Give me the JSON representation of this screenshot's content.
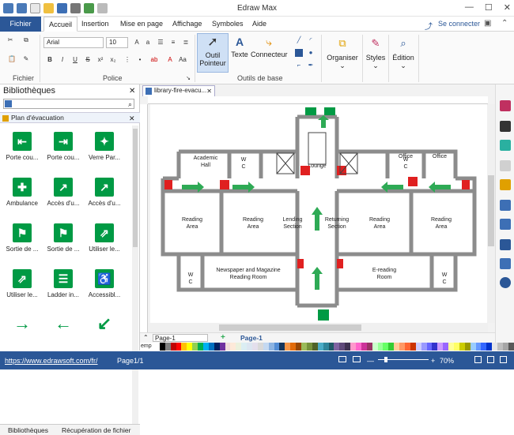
{
  "app": {
    "title": "Edraw Max"
  },
  "window": {
    "minimize": "—",
    "maximize": "☐",
    "close": "✕"
  },
  "menu": {
    "file": "Fichier",
    "tabs": [
      "Accueil",
      "Insertion",
      "Mise en page",
      "Affichage",
      "Symboles",
      "Aide"
    ],
    "signin": "Se connecter"
  },
  "ribbon": {
    "font_name": "Arial",
    "font_size": "10",
    "groups": {
      "file": "Fichier",
      "font": "Police",
      "tools": "Outils de base"
    },
    "pointer_line1": "Outil",
    "pointer_line2": "Pointeur",
    "text_tool": "Texte",
    "connector_tool": "Connecteur",
    "organize": "Organiser",
    "styles": "Styles",
    "edit": "Édition"
  },
  "library": {
    "title": "Bibliothèques",
    "category": "Plan d'évacuation",
    "shapes": [
      {
        "label": "Porte cou...",
        "glyph": "⇤"
      },
      {
        "label": "Porte cou...",
        "glyph": "⇥"
      },
      {
        "label": "Verre Par...",
        "glyph": "✦"
      },
      {
        "label": "Ambulance",
        "glyph": "✚"
      },
      {
        "label": "Accès d'u...",
        "glyph": "↗"
      },
      {
        "label": "Accès d'u...",
        "glyph": "↗"
      },
      {
        "label": "Sortie de ...",
        "glyph": "⚑"
      },
      {
        "label": "Sortie de ...",
        "glyph": "⚑"
      },
      {
        "label": "Utiliser le...",
        "glyph": "⇗"
      },
      {
        "label": "Utiliser le...",
        "glyph": "⇗"
      },
      {
        "label": "Ladder in...",
        "glyph": "☰"
      },
      {
        "label": "Accessibl...",
        "glyph": "♿"
      }
    ],
    "tab_libraries": "Bibliothèques",
    "tab_recovery": "Récupération de fichier"
  },
  "document": {
    "tab": "library-fire-evacu..."
  },
  "floorplan": {
    "rooms": [
      {
        "id": "academic",
        "text": [
          "Academic",
          "Hall"
        ]
      },
      {
        "id": "wc1",
        "text": [
          "W",
          "C"
        ]
      },
      {
        "id": "lounge",
        "text": [
          "Lounge"
        ]
      },
      {
        "id": "wc2",
        "text": [
          "W",
          "C"
        ]
      },
      {
        "id": "office1",
        "text": [
          "Office"
        ]
      },
      {
        "id": "office2",
        "text": [
          "Office"
        ]
      },
      {
        "id": "reading1",
        "text": [
          "Reading",
          "Area"
        ]
      },
      {
        "id": "reading2",
        "text": [
          "Reading",
          "Area"
        ]
      },
      {
        "id": "lending",
        "text": [
          "Lending",
          "Section"
        ]
      },
      {
        "id": "returning",
        "text": [
          "Returning",
          "Section"
        ]
      },
      {
        "id": "reading3",
        "text": [
          "Reading",
          "Area"
        ]
      },
      {
        "id": "reading4",
        "text": [
          "Reading",
          "Area"
        ]
      },
      {
        "id": "wc3",
        "text": [
          "W",
          "C"
        ]
      },
      {
        "id": "newspaper",
        "text": [
          "Newspaper and Magazine",
          "Reading Room"
        ]
      },
      {
        "id": "ereading",
        "text": [
          "E-reading",
          "Room"
        ]
      },
      {
        "id": "wc4",
        "text": [
          "W",
          "C"
        ]
      }
    ]
  },
  "pages": {
    "current": "Page-1",
    "tab": "Page-1",
    "add": "+"
  },
  "palette_label": "emp",
  "palette": [
    "#ffffff",
    "#000000",
    "#7f7f7f",
    "#c00000",
    "#ff0000",
    "#ffc000",
    "#ffff00",
    "#92d050",
    "#00b050",
    "#00b0f0",
    "#0070c0",
    "#002060",
    "#7030a0",
    "#f2dcdb",
    "#fde9d9",
    "#ebf1dd",
    "#dbeef3",
    "#dce6f1",
    "#e4dfec",
    "#d9d9d9",
    "#c5d9f1",
    "#8db4e2",
    "#538dd5",
    "#16365c",
    "#f79646",
    "#e26b0a",
    "#974706",
    "#9bbb59",
    "#76923c",
    "#4f6228",
    "#4bacc6",
    "#31869b",
    "#215967",
    "#8064a2",
    "#5f497a",
    "#3f3151",
    "#ff99cc",
    "#ff66cc",
    "#cc3399",
    "#993366",
    "#ccffcc",
    "#99ff99",
    "#66ff66",
    "#33cc33",
    "#ffcc99",
    "#ff9966",
    "#ff6633",
    "#cc3300",
    "#ccccff",
    "#9999ff",
    "#6666ff",
    "#3333cc",
    "#cc99ff",
    "#9966ff",
    "#ffff99",
    "#ffff66",
    "#cccc00",
    "#999900",
    "#99ccff",
    "#6699ff",
    "#3366ff",
    "#0033cc",
    "#e6e6e6",
    "#bfbfbf",
    "#a6a6a6",
    "#595959"
  ],
  "status": {
    "url": "https://www.edrawsoft.com/fr/",
    "page": "Page1/1",
    "zoom": "70%"
  }
}
